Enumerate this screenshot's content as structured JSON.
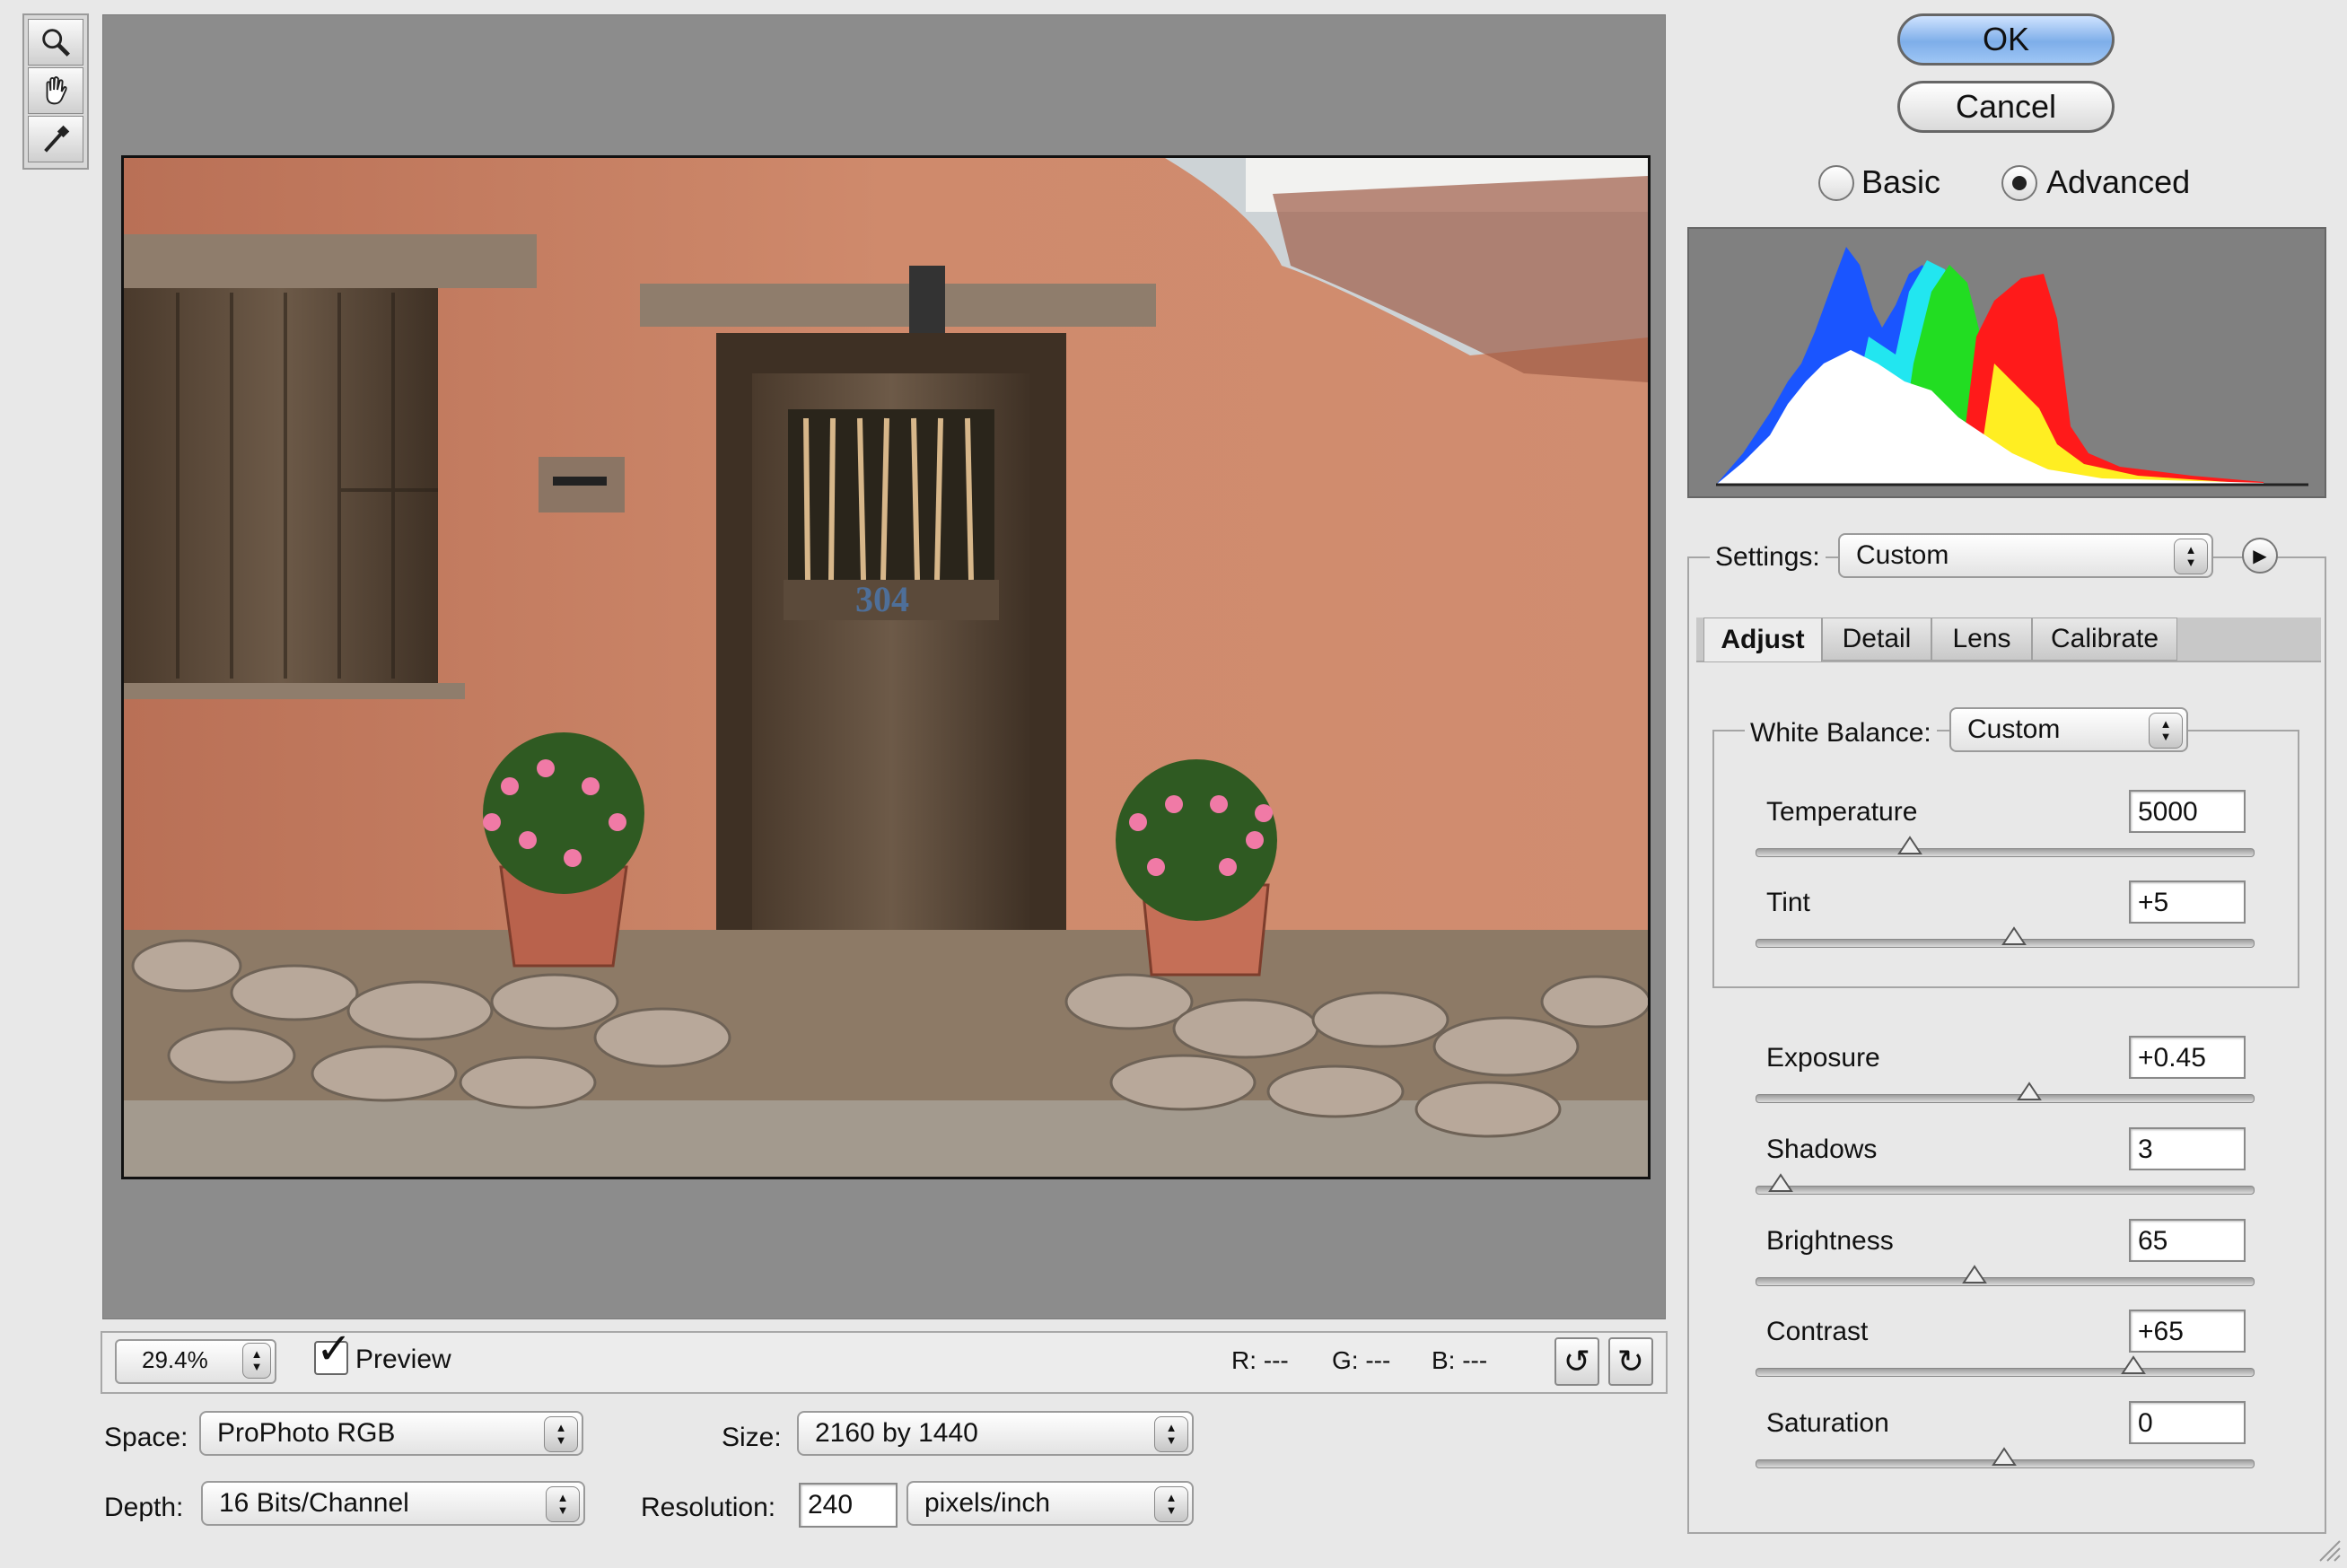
{
  "tools": [
    {
      "icon": "zoom-tool-icon"
    },
    {
      "icon": "hand-tool-icon"
    },
    {
      "icon": "white-balance-eyedropper-icon"
    }
  ],
  "preview": {
    "image_subject": "adobe-wall-with-wooden-door-photo",
    "door_number": "304"
  },
  "status": {
    "zoom": "29.4%",
    "preview_label": "Preview",
    "preview_checked": true,
    "r": "R:  ---",
    "g": "G:  ---",
    "b": "B:  ---",
    "rotate_left_icon": "rotate-ccw-icon",
    "rotate_right_icon": "rotate-cw-icon"
  },
  "workflow": {
    "space_label": "Space:",
    "space_value": "ProPhoto RGB",
    "depth_label": "Depth:",
    "depth_value": "16 Bits/Channel",
    "size_label": "Size:",
    "size_value": "2160 by 1440",
    "resolution_label": "Resolution:",
    "resolution_value": "240",
    "resolution_unit": "pixels/inch"
  },
  "buttons": {
    "ok": "OK",
    "cancel": "Cancel"
  },
  "mode": {
    "basic": "Basic",
    "advanced": "Advanced",
    "selected": "Advanced"
  },
  "settings": {
    "label": "Settings:",
    "value": "Custom"
  },
  "tabs": [
    {
      "label": "Adjust",
      "active": true
    },
    {
      "label": "Detail",
      "active": false
    },
    {
      "label": "Lens",
      "active": false
    },
    {
      "label": "Calibrate",
      "active": false
    }
  ],
  "white_balance": {
    "label": "White Balance:",
    "value": "Custom"
  },
  "sliders": {
    "temperature": {
      "label": "Temperature",
      "value": "5000",
      "position": 0.31
    },
    "tint": {
      "label": "Tint",
      "value": "+5",
      "position": 0.52
    },
    "exposure": {
      "label": "Exposure",
      "value": "+0.45",
      "position": 0.55
    },
    "shadows": {
      "label": "Shadows",
      "value": "3",
      "position": 0.05
    },
    "brightness": {
      "label": "Brightness",
      "value": "65",
      "position": 0.44
    },
    "contrast": {
      "label": "Contrast",
      "value": "+65",
      "position": 0.76
    },
    "saturation": {
      "label": "Saturation",
      "value": "0",
      "position": 0.5
    }
  },
  "colors": {
    "ok_button": "#8db9ee",
    "histogram_bg": "#808080",
    "wall": "#c77f62",
    "red_channel": "#ff1a1a",
    "green_channel": "#22dd22",
    "blue_channel": "#1a55ff",
    "cyan": "#22e6f0",
    "yellow": "#ffee22"
  }
}
